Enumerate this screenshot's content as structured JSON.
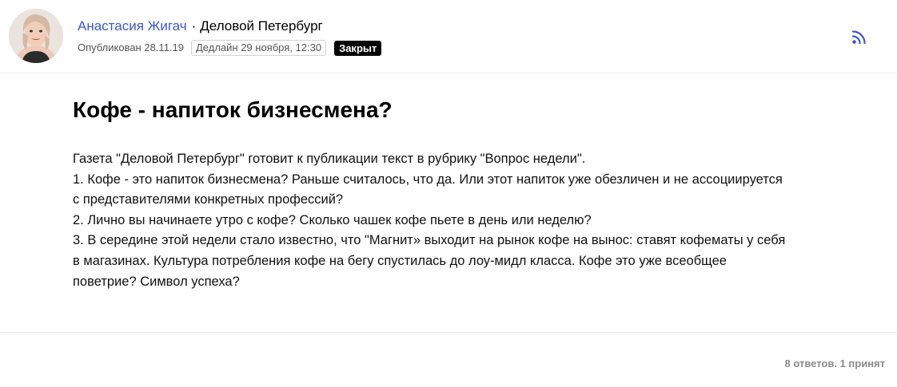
{
  "post": {
    "author": "Анастасия Жигач",
    "separator": "·",
    "publication": "Деловой Петербург",
    "published": "Опубликован 28.11.19",
    "deadline": "Дедлайн 29 ноября, 12:30",
    "status": "Закрыт",
    "title": "Кофе - напиток бизнесмена?",
    "body_lines": [
      "Газета \"Деловой Петербург\" готовит к публикации текст в рубрику \"Вопрос недели\".",
      "1. Кофе - это напиток бизнесмена? Раньше считалось, что да. Или этот напиток уже обезличен и не ассоциируется",
      "с представителями конкретных профессий?",
      "2. Лично вы начинаете утро с кофе? Сколько чашек кофе пьете в день или неделю?",
      "3. В середине этой недели стало известно, что \"Магнит» выходит на рынок кофе на вынос: ставят кофематы у себя",
      "в магазинах. Культура потребления кофе на бегу спустилась до лоу-мидл класса. Кофе это уже всеобщее",
      "поветрие? Символ успеха?"
    ]
  },
  "footer": {
    "answers": "8 ответов. 1 принят"
  },
  "icons": {
    "rss": "rss-icon",
    "avatar": "author-avatar"
  },
  "colors": {
    "author_link": "#3b57d3",
    "badge_bg": "#000000",
    "rss": "#3b57d3"
  }
}
